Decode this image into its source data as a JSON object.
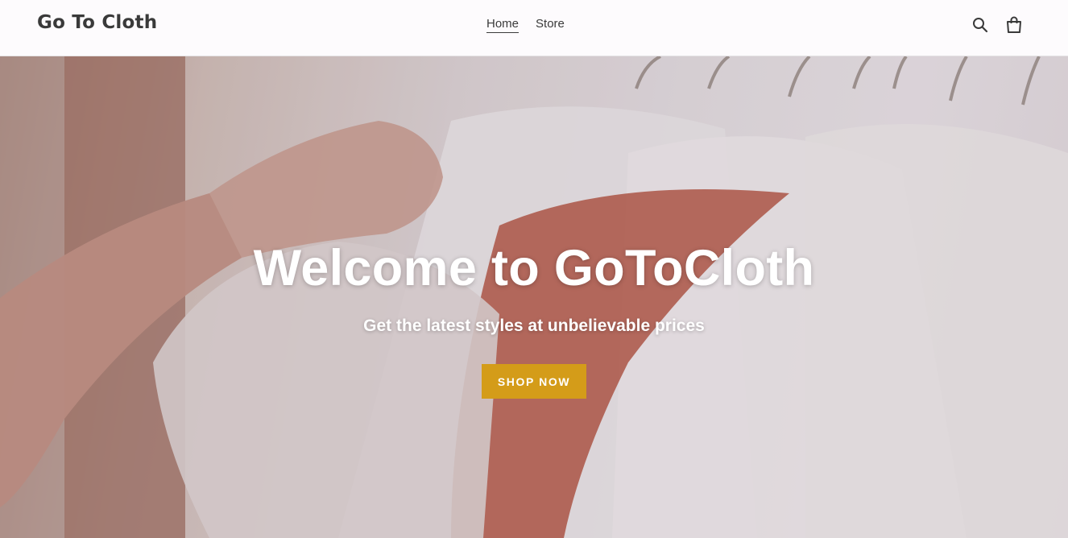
{
  "header": {
    "logo": "Go To Cloth",
    "nav": [
      {
        "label": "Home",
        "active": true
      },
      {
        "label": "Store",
        "active": false
      }
    ],
    "icons": [
      "search-icon",
      "cart-icon"
    ]
  },
  "hero": {
    "title": "Welcome to GoToCloth",
    "subtitle": "Get the latest styles at unbelievable prices",
    "cta_label": "SHOP NOW",
    "cta_color": "#d49c19"
  }
}
